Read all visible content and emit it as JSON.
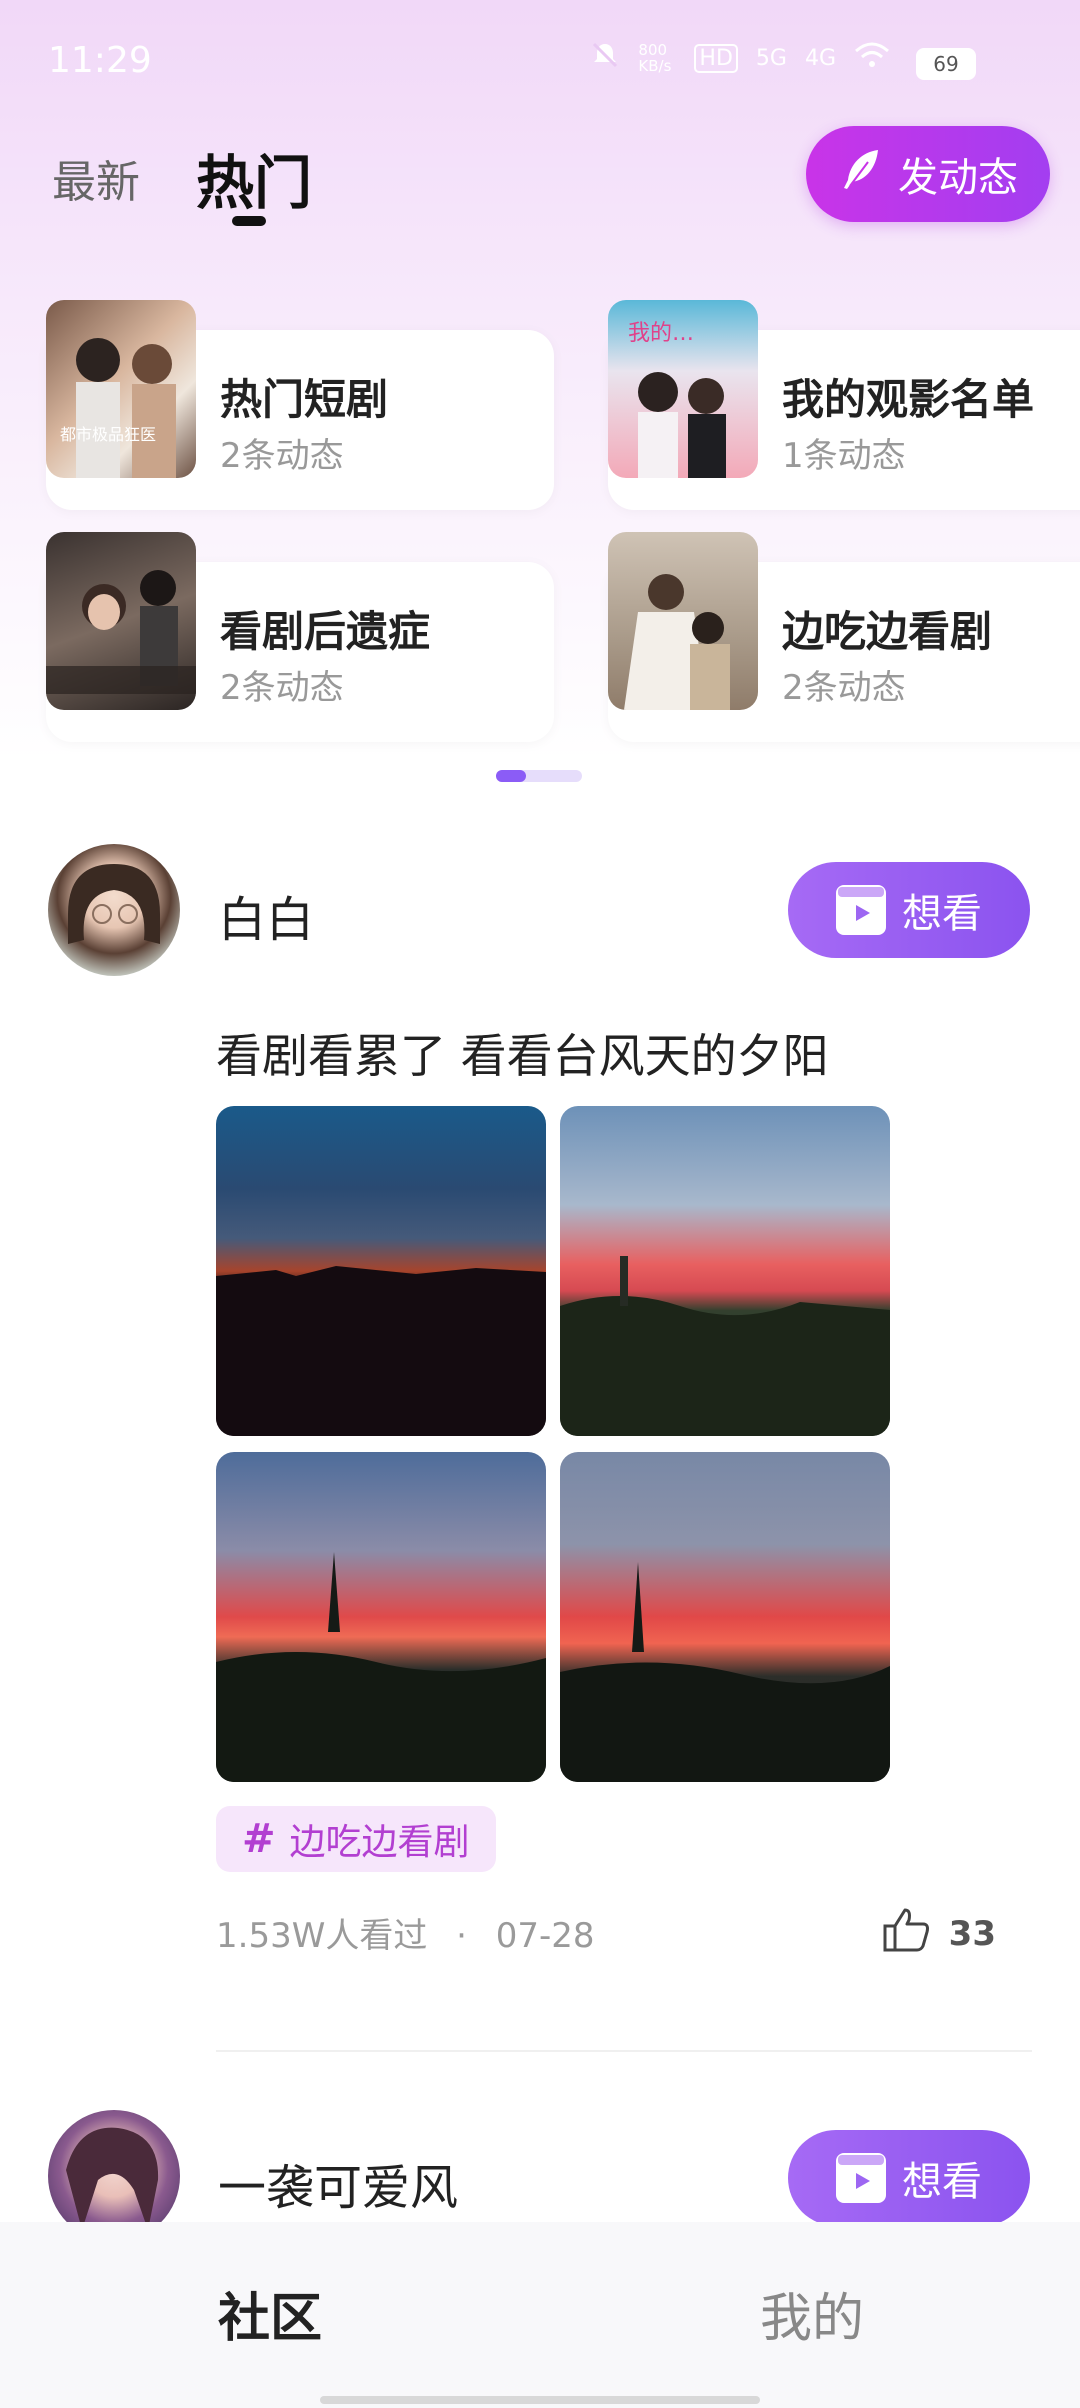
{
  "status_bar": {
    "time": "11:29",
    "net_speed": "800 KB/s",
    "hd_label": "HD",
    "signal_5g": "5G",
    "signal_4g": "4G",
    "battery": "69"
  },
  "header": {
    "tab_latest": "最新",
    "tab_hot": "热门",
    "post_button": "发动态"
  },
  "categories": [
    {
      "title": "热门短剧",
      "count": "2条动态"
    },
    {
      "title": "我的观影名单",
      "count": "1条动态"
    },
    {
      "title": "看剧后遗症",
      "count": "2条动态"
    },
    {
      "title": "边吃边看剧",
      "count": "2条动态"
    }
  ],
  "posts": [
    {
      "username": "白白",
      "want_label": "想看",
      "text": "看剧看累了 看看台风天的夕阳",
      "tag": "边吃边看剧",
      "views": "1.53W人看过",
      "date": "07-28",
      "likes": "33"
    },
    {
      "username": "一袭可爱风",
      "want_label": "想看"
    }
  ],
  "bottom_nav": {
    "community": "社区",
    "mine": "我的"
  },
  "colors": {
    "accent_purple": "#8b53ef",
    "post_button": "#c934e8",
    "tag_text": "#b23fd1"
  }
}
